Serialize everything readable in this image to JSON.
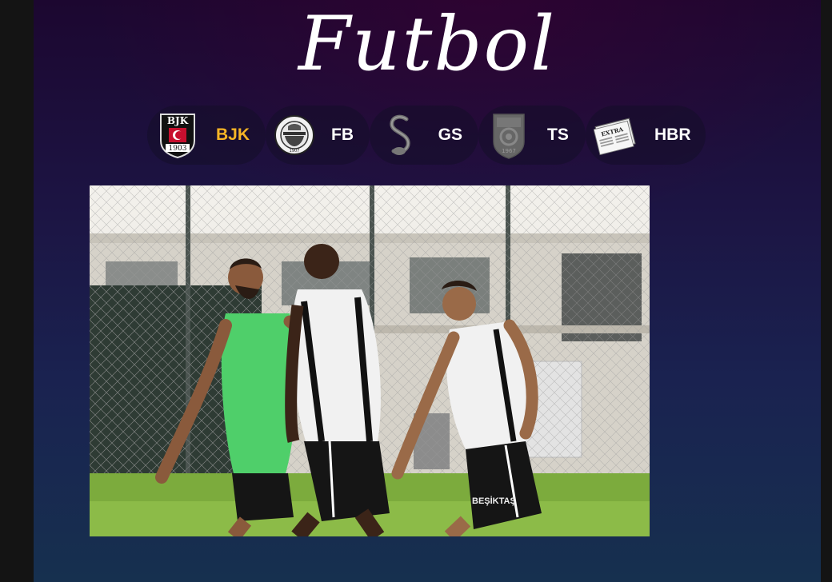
{
  "page": {
    "title": "Futbol"
  },
  "tabs": [
    {
      "label": "BJK",
      "logo_icon": "besiktas-crest-icon",
      "logo_text": "BJK",
      "logo_year": "1903",
      "active": true
    },
    {
      "label": "FB",
      "logo_icon": "fenerbahce-crest-icon",
      "logo_year": "1907",
      "active": false
    },
    {
      "label": "GS",
      "logo_icon": "galatasaray-crest-icon",
      "active": false
    },
    {
      "label": "TS",
      "logo_icon": "trabzonspor-crest-icon",
      "logo_year": "1967",
      "active": false
    },
    {
      "label": "HBR",
      "logo_icon": "newspaper-icon",
      "logo_text": "EXTRA",
      "active": false
    }
  ],
  "photo": {
    "kit_text": "BEŞİKTAŞ"
  },
  "colors": {
    "active_tab": "#f5b425",
    "text": "#ffffff"
  }
}
